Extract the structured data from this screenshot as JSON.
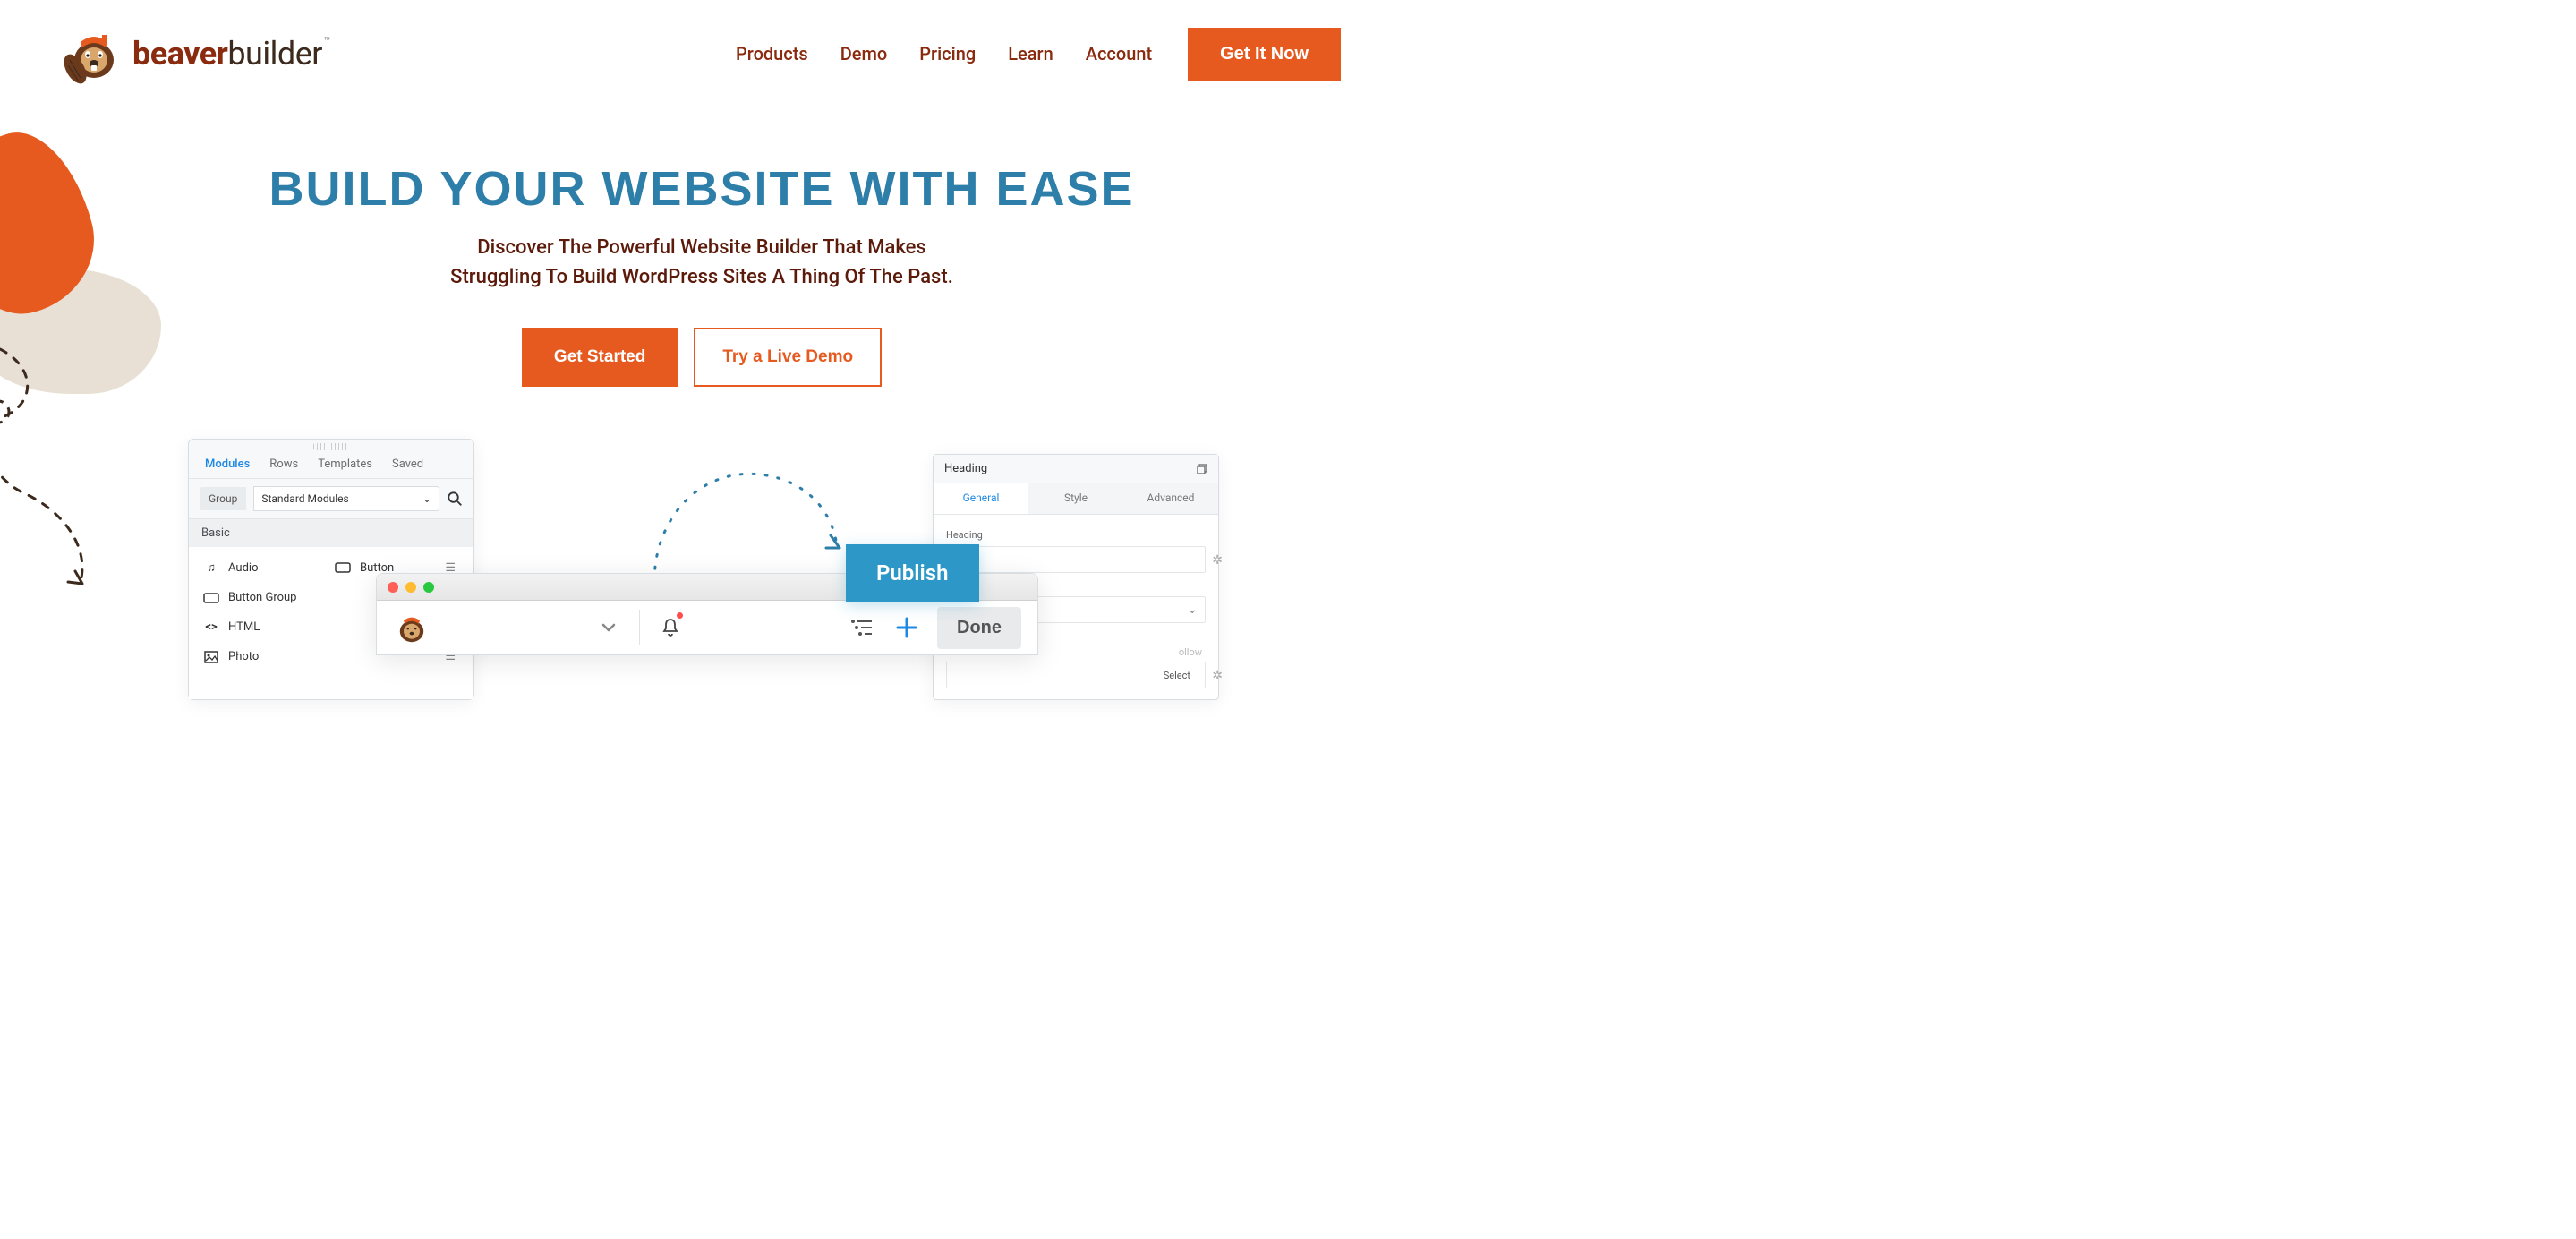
{
  "brand": {
    "name_part1": "beaver",
    "name_part2": "builder",
    "trademark": "™"
  },
  "nav": {
    "items": [
      "Products",
      "Demo",
      "Pricing",
      "Learn",
      "Account"
    ],
    "cta": "Get It Now"
  },
  "hero": {
    "title": "BUILD YOUR WEBSITE WITH EASE",
    "subtitle_line1": "Discover The Powerful Website Builder That Makes",
    "subtitle_line2": "Struggling To Build WordPress Sites A Thing Of The Past.",
    "primary_btn": "Get Started",
    "secondary_btn": "Try a Live Demo"
  },
  "modules_panel": {
    "tabs": [
      "Modules",
      "Rows",
      "Templates",
      "Saved"
    ],
    "active_tab": "Modules",
    "group_label": "Group",
    "group_value": "Standard Modules",
    "section": "Basic",
    "items": [
      {
        "icon": "audio",
        "label": "Audio"
      },
      {
        "icon": "button",
        "label": "Button"
      },
      {
        "icon": "button-group",
        "label": "Button Group"
      },
      {
        "icon": "html",
        "label": "HTML"
      },
      {
        "icon": "photo",
        "label": "Photo"
      }
    ]
  },
  "browser": {
    "done": "Done"
  },
  "publish": {
    "label": "Publish"
  },
  "settings_panel": {
    "title": "Heading",
    "tabs": [
      "General",
      "Style",
      "Advanced"
    ],
    "active_tab": "General",
    "field_label": "Heading",
    "select_btn": "Select",
    "partial_text": "ollow"
  },
  "colors": {
    "accent_orange": "#e65a1f",
    "brand_maroon": "#8a2a0e",
    "title_blue": "#2d7ea8",
    "publish_blue": "#2d97c7",
    "link_blue": "#1e88e5"
  }
}
